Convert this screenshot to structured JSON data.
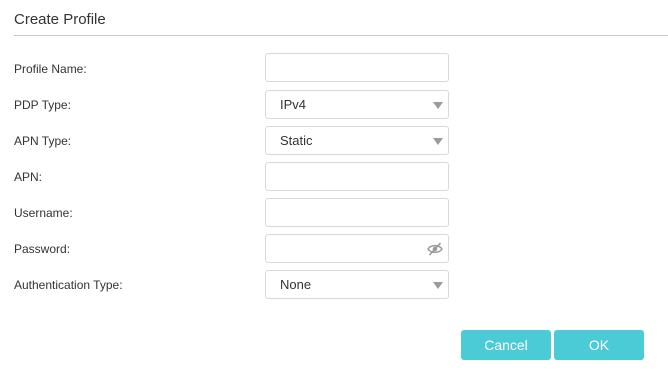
{
  "dialog": {
    "title": "Create Profile"
  },
  "form": {
    "profile_name": {
      "label": "Profile Name:",
      "value": ""
    },
    "pdp_type": {
      "label": "PDP Type:",
      "value": "IPv4"
    },
    "apn_type": {
      "label": "APN Type:",
      "value": "Static"
    },
    "apn": {
      "label": "APN:",
      "value": ""
    },
    "username": {
      "label": "Username:",
      "value": ""
    },
    "password": {
      "label": "Password:",
      "value": "",
      "icon": "eye-off-icon"
    },
    "auth_type": {
      "label": "Authentication Type:",
      "value": "None"
    }
  },
  "buttons": {
    "cancel_label": "Cancel",
    "ok_label": "OK"
  },
  "colors": {
    "button_bg": "#4acbd6",
    "button_text": "#ffffff",
    "field_border": "#d9d9d9",
    "text": "#333333"
  }
}
